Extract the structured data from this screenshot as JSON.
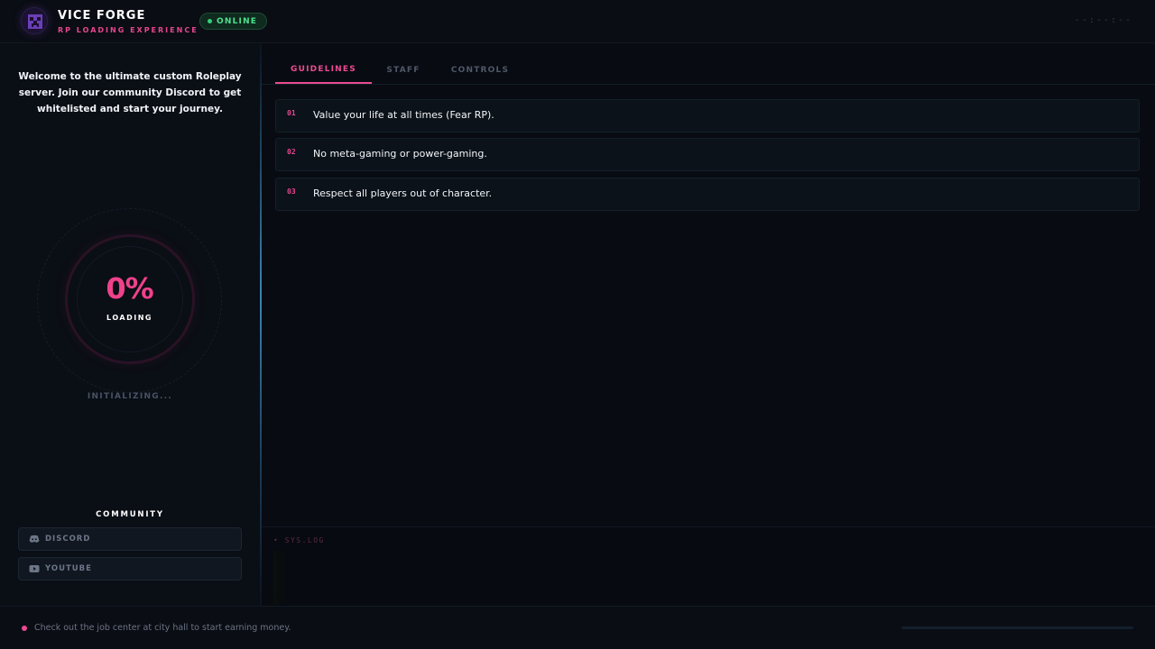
{
  "header": {
    "logo_icon": "creeper-skull-icon",
    "title": "VICE FORGE",
    "subtitle": "RP LOADING EXPERIENCE",
    "status": "ONLINE",
    "clock": "--:--:--"
  },
  "sidebar": {
    "welcome": "Welcome to the ultimate custom Roleplay server. Join our community Discord to get whitelisted and start your journey.",
    "loader": {
      "percent_text": "0%",
      "progress": 0,
      "label": "LOADING",
      "status": "INITIALIZING..."
    },
    "community": {
      "title": "COMMUNITY",
      "links": [
        {
          "label": "DISCORD",
          "icon": "discord-icon"
        },
        {
          "label": "YOUTUBE",
          "icon": "youtube-icon"
        }
      ]
    }
  },
  "main": {
    "tabs": [
      {
        "label": "GUIDELINES",
        "active": true
      },
      {
        "label": "STAFF",
        "active": false
      },
      {
        "label": "CONTROLS",
        "active": false
      }
    ],
    "rules": [
      {
        "num": "01",
        "text": "Value your life at all times (Fear RP)."
      },
      {
        "num": "02",
        "text": "No meta-gaming or power-gaming."
      },
      {
        "num": "03",
        "text": "Respect all players out of character."
      }
    ],
    "log": {
      "title": "• SYS.LOG"
    }
  },
  "footer": {
    "tip": "Check out the job center at city hall to start earning money.",
    "progress": 0
  },
  "colors": {
    "accent": "#ec4a92",
    "online": "#34d07a",
    "background": "#080b12"
  }
}
